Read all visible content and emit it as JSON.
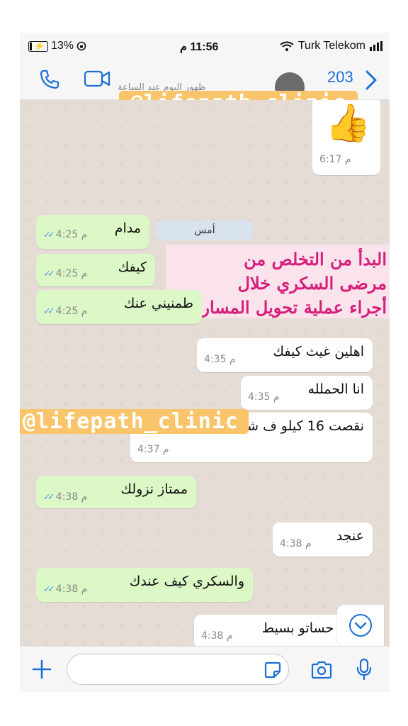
{
  "status_bar": {
    "battery": "13%",
    "battery_level": 0.13,
    "time": "11:56 م",
    "carrier": "Turk Telekom"
  },
  "header": {
    "subtitle": "ظهور اليوم عند الساعة",
    "unread_count": "203",
    "watermark": "@lifepath_clinic"
  },
  "chat": {
    "watermark": "@lifepath_clinic",
    "day_separator": "أمس",
    "promo_lines": [
      "البدأ من التخلص من",
      "مرضى السكري خلال",
      "أجراء عملية تحويل المسار"
    ],
    "messages": [
      {
        "type": "in",
        "text": "👍",
        "time": "6:17 م"
      },
      {
        "type": "out",
        "text": "مدام",
        "time": "4:25 م"
      },
      {
        "type": "out",
        "text": "كيفك",
        "time": "4:25 م"
      },
      {
        "type": "out",
        "text": "طمنيني عنك",
        "time": "4:25 م"
      },
      {
        "type": "in",
        "text": "اهلين غيث كيفك",
        "time": "4:35 م"
      },
      {
        "type": "in",
        "text": "انا الحملله",
        "time": "4:35 م"
      },
      {
        "type": "in",
        "text": "نقصت 16 كيلو ف شهر وعشره ايام",
        "time": "4:37 م"
      },
      {
        "type": "out",
        "text": "ممتاز نزولك",
        "time": "4:38 م"
      },
      {
        "type": "in",
        "text": "عنجد",
        "time": "4:38 م"
      },
      {
        "type": "out",
        "text": "والسكري كيف عندك",
        "time": "4:38 م"
      },
      {
        "type": "in",
        "text": "والله حساتو بسيط",
        "time": "4:38 م"
      }
    ]
  },
  "colors": {
    "outgoing_bubble": "#dcf8c6",
    "incoming_bubble": "#ffffff",
    "accent": "#1a6fd6",
    "promo_text": "#d61e7a",
    "watermark_bg": "#f9c46a"
  },
  "icons": [
    "battery-icon",
    "lock-rotation-icon",
    "wifi-icon",
    "signal-icon",
    "phone-icon",
    "video-icon",
    "chevron-right-icon",
    "chevron-down-icon",
    "plus-icon",
    "sticker-icon",
    "camera-icon",
    "mic-icon"
  ]
}
